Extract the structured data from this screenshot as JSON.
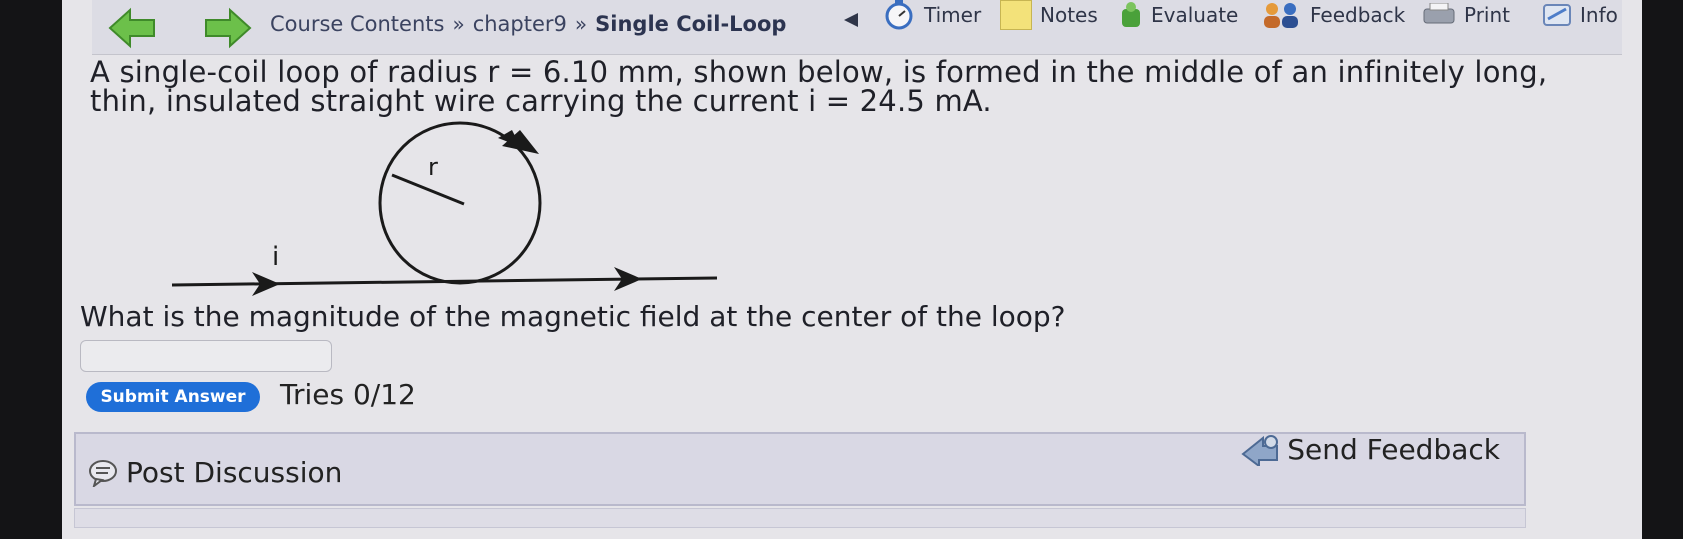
{
  "toolbar": {
    "breadcrumb": [
      "Course Contents",
      "chapter9",
      "Single Coil-Loop"
    ],
    "separator": "»",
    "timer_label": "Timer",
    "notes_label": "Notes",
    "evaluate_label": "Evaluate",
    "feedback_label": "Feedback",
    "print_label": "Print",
    "info_label": "Info"
  },
  "question": {
    "text": "A single-coil loop of radius r = 6.10 mm, shown below, is formed in the middle of an infinitely long, thin, insulated straight wire carrying the current i = 24.5 mA.",
    "prompt": "What is the magnitude of the magnetic field at the center of the loop?"
  },
  "figure": {
    "radius_label": "r",
    "current_label": "i"
  },
  "answer": {
    "value": "",
    "submit_label": "Submit Answer",
    "tries": "Tries 0/12"
  },
  "discussion": {
    "post_label": "Post Discussion",
    "send_feedback_label": "Send Feedback"
  },
  "colors": {
    "nav_arrow": "#6cc04a",
    "submit": "#1f6fd8",
    "notes": "#f3e27a"
  }
}
